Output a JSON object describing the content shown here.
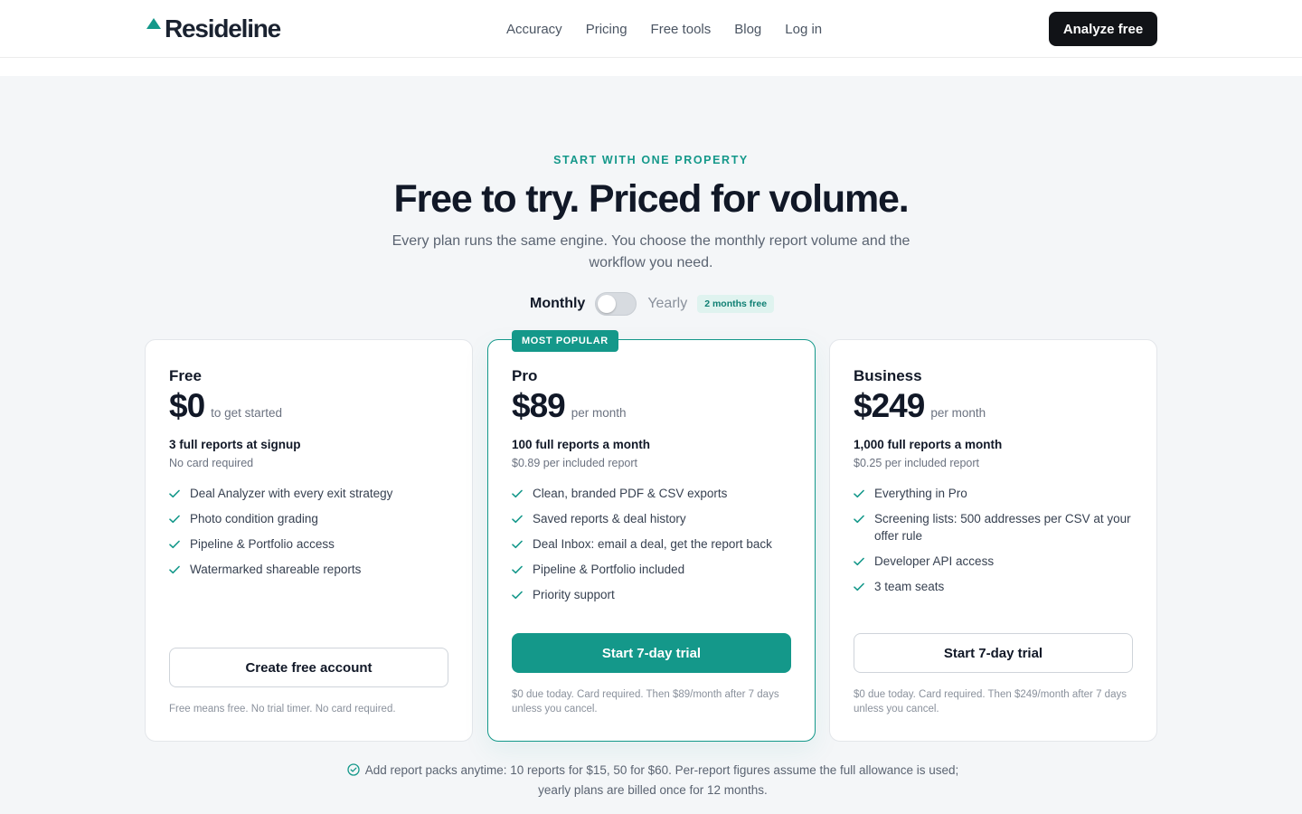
{
  "header": {
    "logo_text": "Resideline",
    "nav": [
      "Accuracy",
      "Pricing",
      "Free tools",
      "Blog",
      "Log in"
    ],
    "cta_label": "Analyze free"
  },
  "hero": {
    "eyebrow": "START WITH ONE PROPERTY",
    "title": "Free to try. Priced for volume.",
    "subtitle": "Every plan runs the same engine. You choose the monthly report volume and the workflow you need."
  },
  "billing": {
    "monthly_label": "Monthly",
    "yearly_label": "Yearly",
    "yearly_selected": false,
    "badge": "2 months free"
  },
  "plans": [
    {
      "name": "Free",
      "price": "$0",
      "unit": "to get started",
      "allowance": "3 full reports at signup",
      "allowance_sub": "No card required",
      "features": [
        "Deal Analyzer with every exit strategy",
        "Photo condition grading",
        "Pipeline & Portfolio access",
        "Watermarked shareable reports"
      ],
      "cta": "Create free account",
      "fine_print": "Free means free. No trial timer. No card required."
    },
    {
      "name": "Pro",
      "badge": "MOST POPULAR",
      "price": "$89",
      "unit": "per month",
      "allowance": "100 full reports a month",
      "allowance_sub": "$0.89 per included report",
      "features": [
        "Clean, branded PDF & CSV exports",
        "Saved reports & deal history",
        "Deal Inbox: email a deal, get the report back",
        "Pipeline & Portfolio included",
        "Priority support"
      ],
      "cta": "Start 7-day trial",
      "fine_print": "$0 due today. Card required. Then $89/month after 7 days unless you cancel."
    },
    {
      "name": "Business",
      "price": "$249",
      "unit": "per month",
      "allowance": "1,000 full reports a month",
      "allowance_sub": "$0.25 per included report",
      "features": [
        "Everything in Pro",
        "Screening lists: 500 addresses per CSV at your offer rule",
        "Developer API access",
        "3 team seats"
      ],
      "cta": "Start 7-day trial",
      "fine_print": "$0 due today. Card required. Then $249/month after 7 days unless you cancel."
    }
  ],
  "footnote": "Add report packs anytime: 10 reports for $15, 50 for $60. Per-report figures assume the full allowance is used; yearly plans are billed once for 12 months.",
  "colors": {
    "accent": "#14988a",
    "dark": "#111317",
    "background": "#f4f6f8"
  },
  "icons": {
    "feature": "check-icon",
    "footnote": "check-circle-icon",
    "logo": "triangle-logo-icon"
  }
}
